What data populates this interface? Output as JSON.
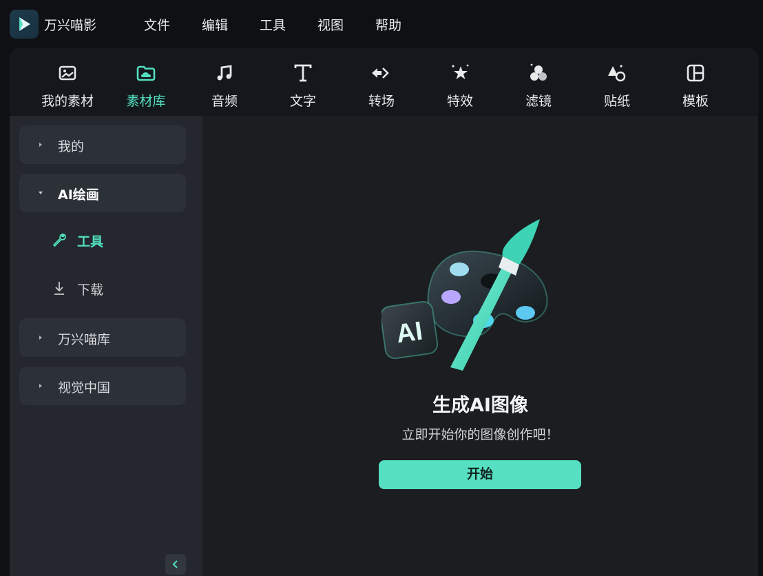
{
  "app": {
    "name": "万兴喵影"
  },
  "menu": [
    {
      "label": "文件"
    },
    {
      "label": "编辑"
    },
    {
      "label": "工具"
    },
    {
      "label": "视图"
    },
    {
      "label": "帮助"
    }
  ],
  "toolbar": {
    "items": [
      {
        "label": "我的素材",
        "icon": "image-icon"
      },
      {
        "label": "素材库",
        "icon": "folder-cloud-icon",
        "active": true
      },
      {
        "label": "音频",
        "icon": "music-note-icon"
      },
      {
        "label": "文字",
        "icon": "text-icon"
      },
      {
        "label": "转场",
        "icon": "transition-arrows-icon"
      },
      {
        "label": "特效",
        "icon": "sparkle-star-icon"
      },
      {
        "label": "滤镜",
        "icon": "filter-circles-icon"
      },
      {
        "label": "贴纸",
        "icon": "sticker-shapes-icon"
      },
      {
        "label": "模板",
        "icon": "template-grid-icon"
      }
    ]
  },
  "sidebar": {
    "groups": [
      {
        "label": "我的",
        "expanded": false
      },
      {
        "label": "AI绘画",
        "expanded": true
      },
      {
        "label": "万兴喵库",
        "expanded": false
      },
      {
        "label": "视觉中国",
        "expanded": false
      }
    ],
    "subitems": [
      {
        "label": "工具",
        "icon": "wrench-icon",
        "active": true
      },
      {
        "label": "下载",
        "icon": "download-icon"
      }
    ]
  },
  "main": {
    "title": "生成AI图像",
    "subtitle": "立即开始你的图像创作吧！",
    "button": "开始",
    "hero_badge": "AI"
  },
  "colors": {
    "accent": "#52e0c0",
    "button": "#56e0c1"
  }
}
